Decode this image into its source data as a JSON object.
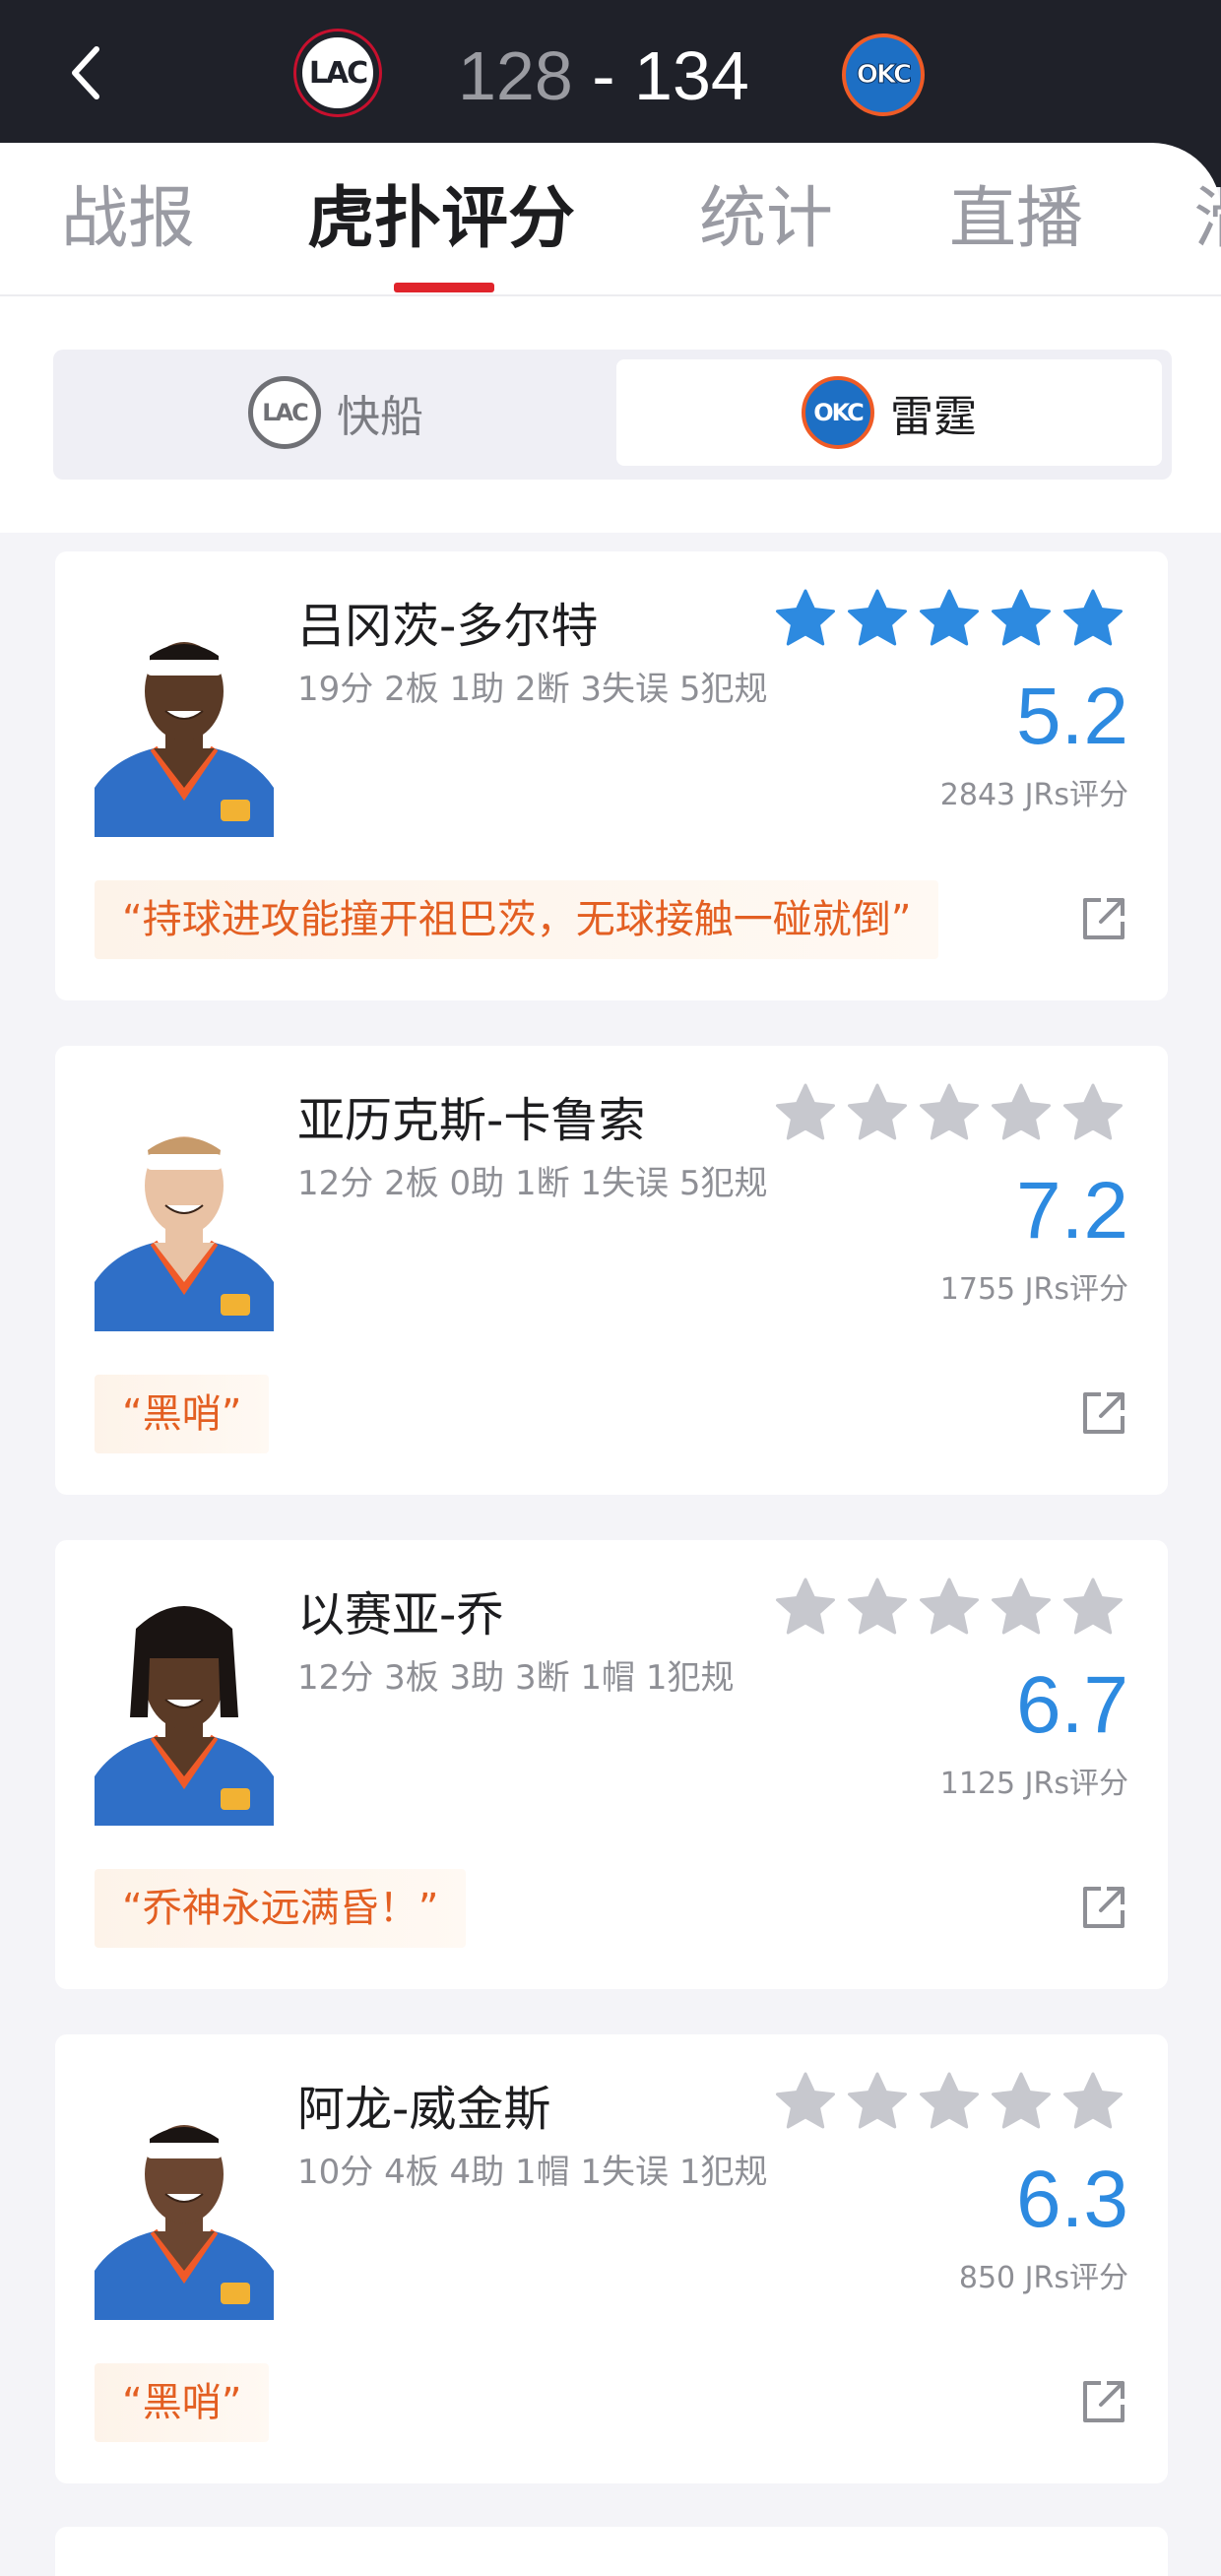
{
  "header": {
    "home_team_logo": "LAC",
    "away_team_logo": "OKC",
    "home_score": "128",
    "separator": "-",
    "away_score": "134"
  },
  "tabs": [
    "战报",
    "虎扑评分",
    "统计",
    "直播",
    "滑"
  ],
  "active_tab": 1,
  "team_toggle": {
    "options": [
      "快船",
      "雷霆"
    ],
    "selected": 1
  },
  "colors": {
    "accent_red": "#e0242b",
    "rating_blue": "#2d8ae0",
    "star_active": "#2d8ae0",
    "star_inactive": "#c7c8ce",
    "quote_orange": "#e35f22"
  },
  "players": [
    {
      "name": "吕冈茨-多尔特",
      "stats": "19分 2板 1助 2断 3失误 5犯规",
      "rating": "5.2",
      "votes": "2843 JRs评分",
      "stars_active": true,
      "quote": "“持球进攻能撞开祖巴茨，无球接触一碰就倒”"
    },
    {
      "name": "亚历克斯-卡鲁索",
      "stats": "12分 2板 0助 1断 1失误 5犯规",
      "rating": "7.2",
      "votes": "1755 JRs评分",
      "stars_active": false,
      "quote": "“黑哨”"
    },
    {
      "name": "以赛亚-乔",
      "stats": "12分 3板 3助 3断 1帽 1犯规",
      "rating": "6.7",
      "votes": "1125 JRs评分",
      "stars_active": false,
      "quote": "“乔神永远满昏！”"
    },
    {
      "name": "阿龙-威金斯",
      "stats": "10分 4板 4助 1帽 1失误 1犯规",
      "rating": "6.3",
      "votes": "850 JRs评分",
      "stars_active": false,
      "quote": "“黑哨”"
    }
  ]
}
